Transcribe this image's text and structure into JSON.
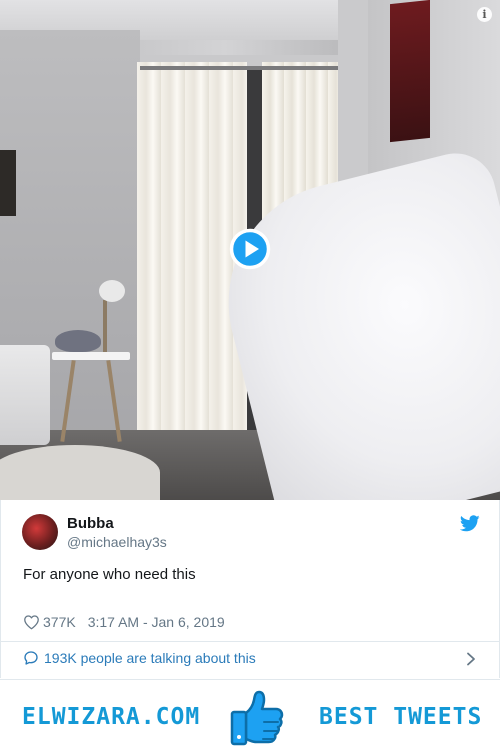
{
  "video": {
    "info_icon": "info-icon",
    "play_icon": "play-icon"
  },
  "tweet": {
    "author": {
      "name": "Bubba",
      "handle": "@michaelhay3s"
    },
    "text": "For anyone who need this",
    "likes": "377K",
    "timestamp": "3:17 AM - Jan 6, 2019",
    "talking": "193K people are talking about this"
  },
  "banner": {
    "left_text": "ELWIZARA.COM",
    "right_text": "BEST TWEETS"
  },
  "colors": {
    "twitter_blue": "#1da1f2",
    "link_blue": "#2b7bb9",
    "brand_blue": "#1499d6",
    "meta_gray": "#657786"
  }
}
